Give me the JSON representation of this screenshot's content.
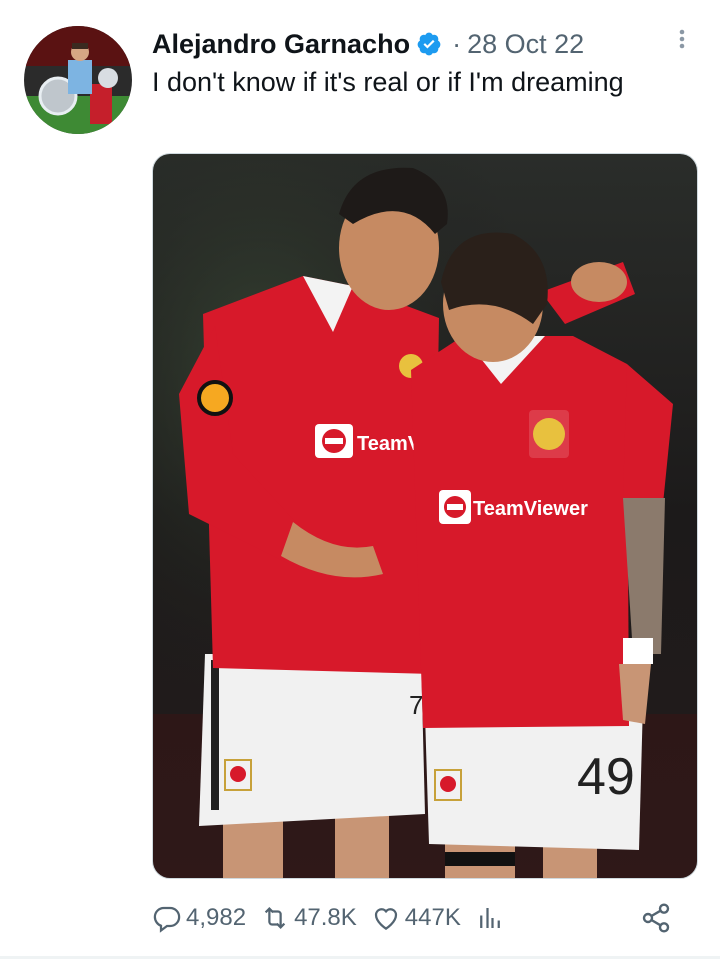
{
  "tweet": {
    "author_name": "Alejandro Garnacho",
    "separator": "·",
    "date": "28 Oct 22",
    "text": "I don't know if it's real or if I'm dreaming"
  },
  "media": {
    "left_player_sponsor": "TeamViewer",
    "right_player_sponsor": "TeamViewer",
    "left_player_number": "7",
    "right_player_number": "49"
  },
  "actions": {
    "replies": "4,982",
    "reposts": "47.8K",
    "likes": "447K"
  },
  "colors": {
    "text_primary": "#0f1419",
    "text_secondary": "#536471",
    "verified_blue": "#1d9bf0",
    "jersey_red": "#d7192a"
  },
  "icons": {
    "verified": "verified-badge-icon",
    "more": "more-vertical-icon",
    "reply": "reply-icon",
    "repost": "repost-icon",
    "like": "heart-icon",
    "views": "views-chart-icon",
    "share": "share-icon"
  }
}
